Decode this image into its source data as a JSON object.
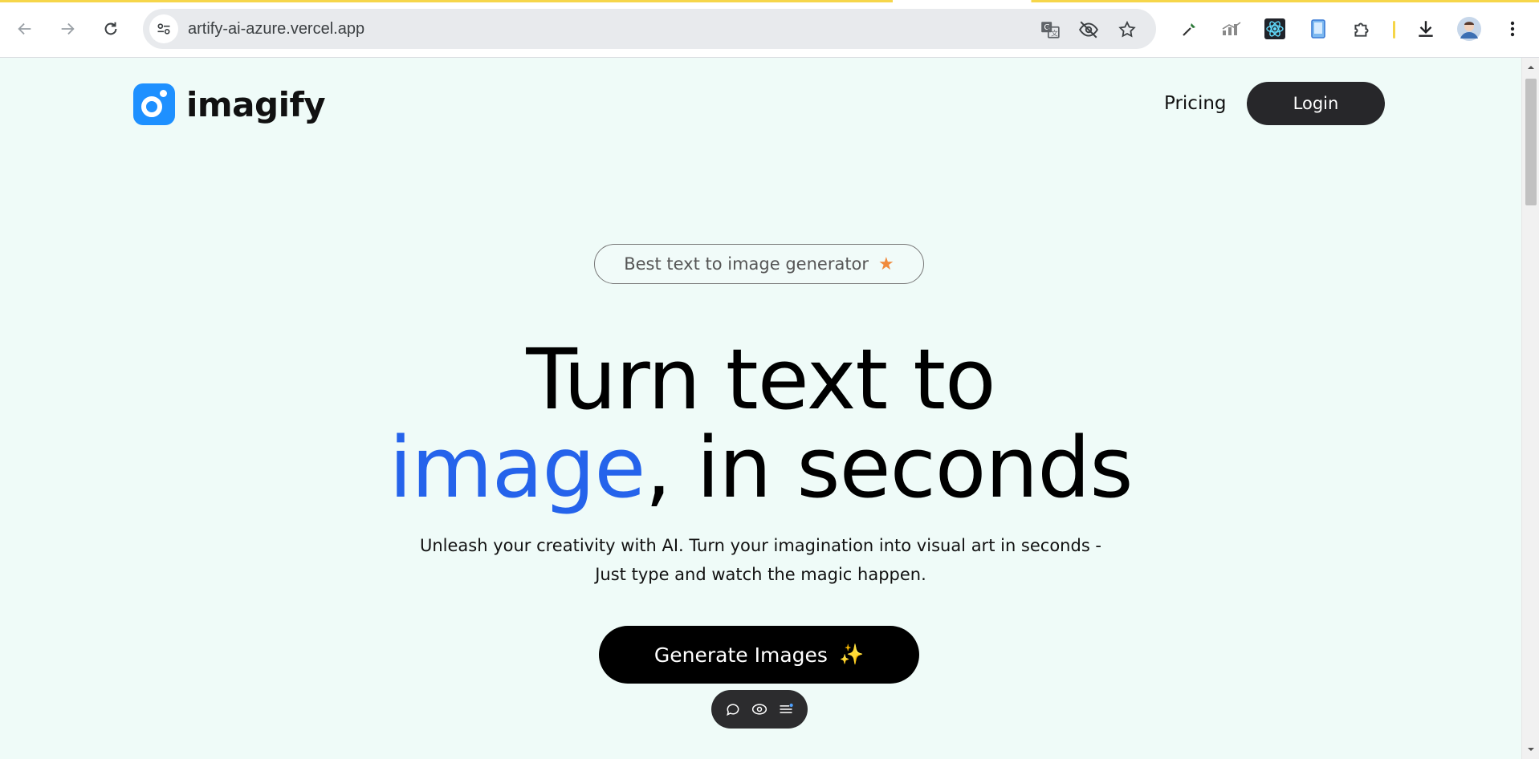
{
  "browser": {
    "url": "artify-ai-azure.vercel.app",
    "icons": [
      "back-icon",
      "forward-icon",
      "reload-icon",
      "site-info-icon",
      "translate-icon",
      "eye-off-icon",
      "star-icon",
      "eyedropper-icon",
      "chart-icon",
      "react-icon",
      "phone-icon",
      "puzzle-icon",
      "download-icon",
      "avatar",
      "menu-icon"
    ]
  },
  "header": {
    "logo_text": "imagify",
    "pricing_label": "Pricing",
    "login_label": "Login"
  },
  "hero": {
    "badge_text": "Best text to image generator",
    "badge_icon": "★",
    "headline_line1": "Turn text to",
    "headline_accent": "image",
    "headline_line2_rest": ", in seconds",
    "subtitle_line1": "Unleash your creativity with AI. Turn your imagination into visual art in seconds -",
    "subtitle_line2": "Just type and watch the magic happen.",
    "cta_label": "Generate Images",
    "cta_icon": "✨"
  },
  "colors": {
    "background": "#effbf8",
    "accent": "#2563eb",
    "brand": "#1e90ff",
    "button_dark": "#000000"
  }
}
